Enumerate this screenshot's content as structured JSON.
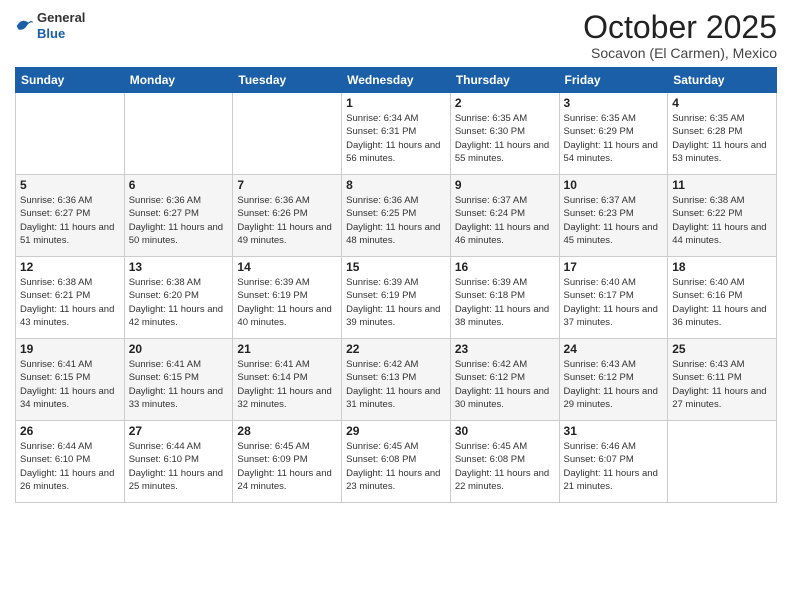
{
  "logo": {
    "general": "General",
    "blue": "Blue"
  },
  "header": {
    "month_year": "October 2025",
    "location": "Socavon (El Carmen), Mexico"
  },
  "weekdays": [
    "Sunday",
    "Monday",
    "Tuesday",
    "Wednesday",
    "Thursday",
    "Friday",
    "Saturday"
  ],
  "weeks": [
    [
      {
        "day": "",
        "sunrise": "",
        "sunset": "",
        "daylight": ""
      },
      {
        "day": "",
        "sunrise": "",
        "sunset": "",
        "daylight": ""
      },
      {
        "day": "",
        "sunrise": "",
        "sunset": "",
        "daylight": ""
      },
      {
        "day": "1",
        "sunrise": "Sunrise: 6:34 AM",
        "sunset": "Sunset: 6:31 PM",
        "daylight": "Daylight: 11 hours and 56 minutes."
      },
      {
        "day": "2",
        "sunrise": "Sunrise: 6:35 AM",
        "sunset": "Sunset: 6:30 PM",
        "daylight": "Daylight: 11 hours and 55 minutes."
      },
      {
        "day": "3",
        "sunrise": "Sunrise: 6:35 AM",
        "sunset": "Sunset: 6:29 PM",
        "daylight": "Daylight: 11 hours and 54 minutes."
      },
      {
        "day": "4",
        "sunrise": "Sunrise: 6:35 AM",
        "sunset": "Sunset: 6:28 PM",
        "daylight": "Daylight: 11 hours and 53 minutes."
      }
    ],
    [
      {
        "day": "5",
        "sunrise": "Sunrise: 6:36 AM",
        "sunset": "Sunset: 6:27 PM",
        "daylight": "Daylight: 11 hours and 51 minutes."
      },
      {
        "day": "6",
        "sunrise": "Sunrise: 6:36 AM",
        "sunset": "Sunset: 6:27 PM",
        "daylight": "Daylight: 11 hours and 50 minutes."
      },
      {
        "day": "7",
        "sunrise": "Sunrise: 6:36 AM",
        "sunset": "Sunset: 6:26 PM",
        "daylight": "Daylight: 11 hours and 49 minutes."
      },
      {
        "day": "8",
        "sunrise": "Sunrise: 6:36 AM",
        "sunset": "Sunset: 6:25 PM",
        "daylight": "Daylight: 11 hours and 48 minutes."
      },
      {
        "day": "9",
        "sunrise": "Sunrise: 6:37 AM",
        "sunset": "Sunset: 6:24 PM",
        "daylight": "Daylight: 11 hours and 46 minutes."
      },
      {
        "day": "10",
        "sunrise": "Sunrise: 6:37 AM",
        "sunset": "Sunset: 6:23 PM",
        "daylight": "Daylight: 11 hours and 45 minutes."
      },
      {
        "day": "11",
        "sunrise": "Sunrise: 6:38 AM",
        "sunset": "Sunset: 6:22 PM",
        "daylight": "Daylight: 11 hours and 44 minutes."
      }
    ],
    [
      {
        "day": "12",
        "sunrise": "Sunrise: 6:38 AM",
        "sunset": "Sunset: 6:21 PM",
        "daylight": "Daylight: 11 hours and 43 minutes."
      },
      {
        "day": "13",
        "sunrise": "Sunrise: 6:38 AM",
        "sunset": "Sunset: 6:20 PM",
        "daylight": "Daylight: 11 hours and 42 minutes."
      },
      {
        "day": "14",
        "sunrise": "Sunrise: 6:39 AM",
        "sunset": "Sunset: 6:19 PM",
        "daylight": "Daylight: 11 hours and 40 minutes."
      },
      {
        "day": "15",
        "sunrise": "Sunrise: 6:39 AM",
        "sunset": "Sunset: 6:19 PM",
        "daylight": "Daylight: 11 hours and 39 minutes."
      },
      {
        "day": "16",
        "sunrise": "Sunrise: 6:39 AM",
        "sunset": "Sunset: 6:18 PM",
        "daylight": "Daylight: 11 hours and 38 minutes."
      },
      {
        "day": "17",
        "sunrise": "Sunrise: 6:40 AM",
        "sunset": "Sunset: 6:17 PM",
        "daylight": "Daylight: 11 hours and 37 minutes."
      },
      {
        "day": "18",
        "sunrise": "Sunrise: 6:40 AM",
        "sunset": "Sunset: 6:16 PM",
        "daylight": "Daylight: 11 hours and 36 minutes."
      }
    ],
    [
      {
        "day": "19",
        "sunrise": "Sunrise: 6:41 AM",
        "sunset": "Sunset: 6:15 PM",
        "daylight": "Daylight: 11 hours and 34 minutes."
      },
      {
        "day": "20",
        "sunrise": "Sunrise: 6:41 AM",
        "sunset": "Sunset: 6:15 PM",
        "daylight": "Daylight: 11 hours and 33 minutes."
      },
      {
        "day": "21",
        "sunrise": "Sunrise: 6:41 AM",
        "sunset": "Sunset: 6:14 PM",
        "daylight": "Daylight: 11 hours and 32 minutes."
      },
      {
        "day": "22",
        "sunrise": "Sunrise: 6:42 AM",
        "sunset": "Sunset: 6:13 PM",
        "daylight": "Daylight: 11 hours and 31 minutes."
      },
      {
        "day": "23",
        "sunrise": "Sunrise: 6:42 AM",
        "sunset": "Sunset: 6:12 PM",
        "daylight": "Daylight: 11 hours and 30 minutes."
      },
      {
        "day": "24",
        "sunrise": "Sunrise: 6:43 AM",
        "sunset": "Sunset: 6:12 PM",
        "daylight": "Daylight: 11 hours and 29 minutes."
      },
      {
        "day": "25",
        "sunrise": "Sunrise: 6:43 AM",
        "sunset": "Sunset: 6:11 PM",
        "daylight": "Daylight: 11 hours and 27 minutes."
      }
    ],
    [
      {
        "day": "26",
        "sunrise": "Sunrise: 6:44 AM",
        "sunset": "Sunset: 6:10 PM",
        "daylight": "Daylight: 11 hours and 26 minutes."
      },
      {
        "day": "27",
        "sunrise": "Sunrise: 6:44 AM",
        "sunset": "Sunset: 6:10 PM",
        "daylight": "Daylight: 11 hours and 25 minutes."
      },
      {
        "day": "28",
        "sunrise": "Sunrise: 6:45 AM",
        "sunset": "Sunset: 6:09 PM",
        "daylight": "Daylight: 11 hours and 24 minutes."
      },
      {
        "day": "29",
        "sunrise": "Sunrise: 6:45 AM",
        "sunset": "Sunset: 6:08 PM",
        "daylight": "Daylight: 11 hours and 23 minutes."
      },
      {
        "day": "30",
        "sunrise": "Sunrise: 6:45 AM",
        "sunset": "Sunset: 6:08 PM",
        "daylight": "Daylight: 11 hours and 22 minutes."
      },
      {
        "day": "31",
        "sunrise": "Sunrise: 6:46 AM",
        "sunset": "Sunset: 6:07 PM",
        "daylight": "Daylight: 11 hours and 21 minutes."
      },
      {
        "day": "",
        "sunrise": "",
        "sunset": "",
        "daylight": ""
      }
    ]
  ]
}
